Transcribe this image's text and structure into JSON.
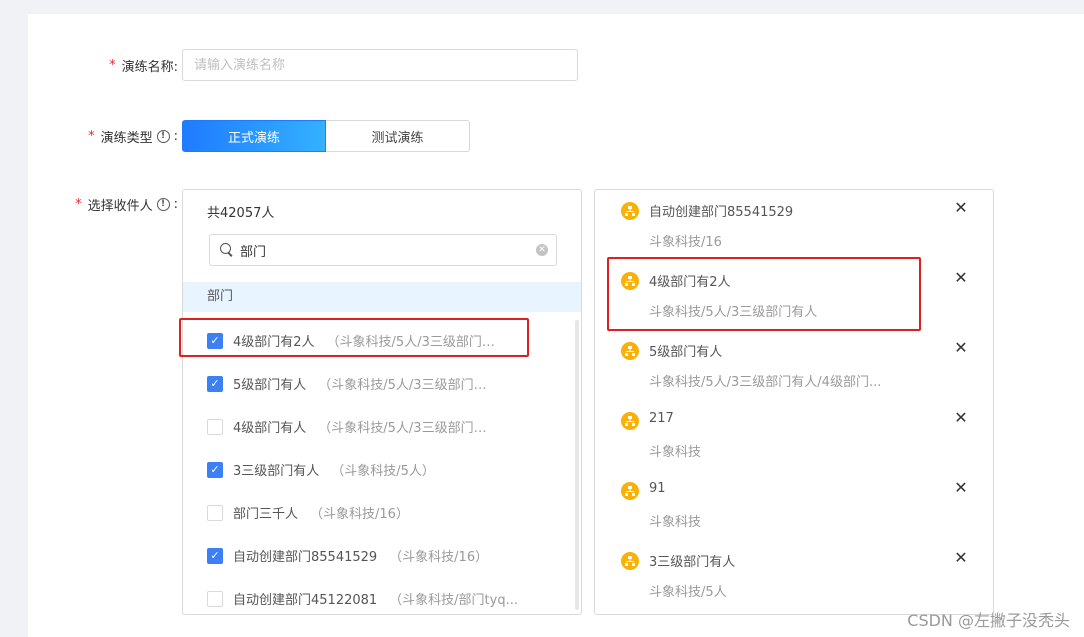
{
  "form": {
    "name_label": "演练名称:",
    "name_placeholder": "请输入演练名称",
    "type_label": "演练类型",
    "type_options": [
      "正式演练",
      "测试演练"
    ],
    "recipients_label": "选择收件人",
    "colon": ":",
    "required_mark": "*",
    "info_glyph": "!"
  },
  "left_panel": {
    "total": "共42057人",
    "search_value": "部门",
    "group_header": "部门",
    "rows": [
      {
        "name": "4级部门有2人",
        "path": "（斗象科技/5人/3三级部门有...",
        "checked": true
      },
      {
        "name": "5级部门有人",
        "path": "（斗象科技/5人/3三级部门有...",
        "checked": true
      },
      {
        "name": "4级部门有人",
        "path": "（斗象科技/5人/3三级部门有...",
        "checked": false
      },
      {
        "name": "3三级部门有人",
        "path": "（斗象科技/5人）",
        "checked": true
      },
      {
        "name": "部门三千人",
        "path": "（斗象科技/16）",
        "checked": false
      },
      {
        "name": "自动创建部门85541529",
        "path": "（斗象科技/16）",
        "checked": true
      },
      {
        "name": "自动创建部门45122081",
        "path": "（斗象科技/部门tyq...",
        "checked": false
      }
    ]
  },
  "right_panel": {
    "items": [
      {
        "name": "自动创建部门85541529",
        "path": "斗象科技/16"
      },
      {
        "name": "4级部门有2人",
        "path": "斗象科技/5人/3三级部门有人"
      },
      {
        "name": "5级部门有人",
        "path": "斗象科技/5人/3三级部门有人/4级部门..."
      },
      {
        "name": "217",
        "path": "斗象科技"
      },
      {
        "name": "91",
        "path": "斗象科技"
      },
      {
        "name": "3三级部门有人",
        "path": "斗象科技/5人"
      }
    ],
    "remove_glyph": "✕"
  },
  "icons": {
    "search": "search-icon",
    "clear": "clear-icon",
    "org": "org-chart-icon",
    "info": "info-circle-icon"
  },
  "colors": {
    "primary": "#1f7bff",
    "required": "#f5222d",
    "highlight": "#e02020",
    "org_icon": "#fab005"
  },
  "watermark": "CSDN @左撇子没秃头"
}
